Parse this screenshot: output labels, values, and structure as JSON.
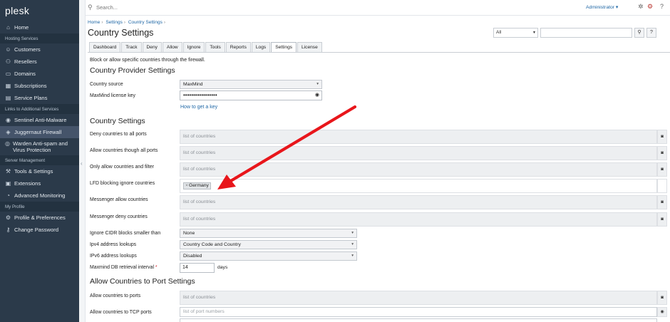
{
  "brand": "plesk",
  "sidebar": {
    "items": [
      {
        "type": "item",
        "icon": "home-icon",
        "glyph": "⌂",
        "label": "Home"
      },
      {
        "type": "section",
        "label": "Hosting Services"
      },
      {
        "type": "item",
        "icon": "customers-icon",
        "glyph": "☺",
        "label": "Customers"
      },
      {
        "type": "item",
        "icon": "resellers-icon",
        "glyph": "⚇",
        "label": "Resellers"
      },
      {
        "type": "item",
        "icon": "domains-icon",
        "glyph": "▭",
        "label": "Domains"
      },
      {
        "type": "item",
        "icon": "subscriptions-icon",
        "glyph": "▦",
        "label": "Subscriptions"
      },
      {
        "type": "item",
        "icon": "service-plans-icon",
        "glyph": "▤",
        "label": "Service Plans"
      },
      {
        "type": "section",
        "label": "Links to Additional Services"
      },
      {
        "type": "item",
        "icon": "shield-icon",
        "glyph": "◉",
        "label": "Sentinel Anti-Malware"
      },
      {
        "type": "item",
        "icon": "firewall-icon",
        "glyph": "◈",
        "label": "Juggernaut Firewall",
        "active": true
      },
      {
        "type": "item",
        "icon": "warden-icon",
        "glyph": "◎",
        "label": "Warden Anti-spam and Virus Protection",
        "two_line": true
      },
      {
        "type": "section",
        "label": "Server Management"
      },
      {
        "type": "item",
        "icon": "tools-icon",
        "glyph": "⚒",
        "label": "Tools & Settings"
      },
      {
        "type": "item",
        "icon": "extensions-icon",
        "glyph": "▣",
        "label": "Extensions"
      },
      {
        "type": "item",
        "icon": "monitoring-icon",
        "glyph": "◔",
        "label": "Advanced Monitoring"
      },
      {
        "type": "section",
        "label": "My Profile"
      },
      {
        "type": "item",
        "icon": "profile-icon",
        "glyph": "⚙",
        "label": "Profile & Preferences"
      },
      {
        "type": "item",
        "icon": "key-icon",
        "glyph": "⚷",
        "label": "Change Password"
      }
    ]
  },
  "topbar": {
    "search_placeholder": "Search...",
    "user": "Administrator ▾"
  },
  "breadcrumb": [
    "Home",
    "Settings",
    "Country Settings"
  ],
  "page_title": "Country Settings",
  "filter": {
    "selected": "All"
  },
  "tabs": [
    {
      "label": "Dashboard",
      "active": false
    },
    {
      "label": "Track",
      "active": false
    },
    {
      "label": "Deny",
      "active": false
    },
    {
      "label": "Allow",
      "active": false
    },
    {
      "label": "Ignore",
      "active": false
    },
    {
      "label": "Tools",
      "active": false
    },
    {
      "label": "Reports",
      "active": false
    },
    {
      "label": "Logs",
      "active": false
    },
    {
      "label": "Settings",
      "active": true
    },
    {
      "label": "License",
      "active": false
    }
  ],
  "description": "Block or allow specific countries through the firewall.",
  "provider": {
    "title": "Country Provider Settings",
    "country_source_label": "Country source",
    "country_source_value": "MaxMind",
    "license_key_label": "MaxMind license key",
    "license_key_value": "•••••••••••••••••",
    "how_to_link": "How to get a key"
  },
  "country_settings": {
    "title": "Country Settings",
    "placeholder": "list of countries",
    "rows": [
      {
        "label": "Deny countries to all ports",
        "tags": []
      },
      {
        "label": "Allow countries though all ports",
        "tags": []
      },
      {
        "label": "Only allow countries and filter",
        "tags": []
      },
      {
        "label": "LFD blocking ignore countries",
        "tags": [
          "Germany"
        ]
      },
      {
        "label": "Messenger allow countries",
        "tags": []
      },
      {
        "label": "Messenger deny countries",
        "tags": []
      }
    ],
    "ignore_cidr_label": "Ignore CIDR blocks smaller than",
    "ignore_cidr_value": "None",
    "ipv4_label": "Ipv4 address lookups",
    "ipv4_value": "Country Code and Country",
    "ipv6_label": "IPv6 address lookups",
    "ipv6_value": "Disabled",
    "maxmind_interval_label": "Maxmind DB retrieval interval",
    "maxmind_interval_value": "14",
    "maxmind_interval_unit": "days"
  },
  "port_settings": {
    "title": "Allow Countries to Port Settings",
    "allow_ports_label": "Allow countries to ports",
    "allow_ports_placeholder": "list of countries",
    "allow_tcp_label": "Allow countries to TCP ports",
    "allow_tcp_placeholder": "list of port numbers"
  },
  "colors": {
    "sidebar_bg": "#2b3a4a",
    "link": "#1f67a6",
    "arrow": "#e8161b"
  }
}
